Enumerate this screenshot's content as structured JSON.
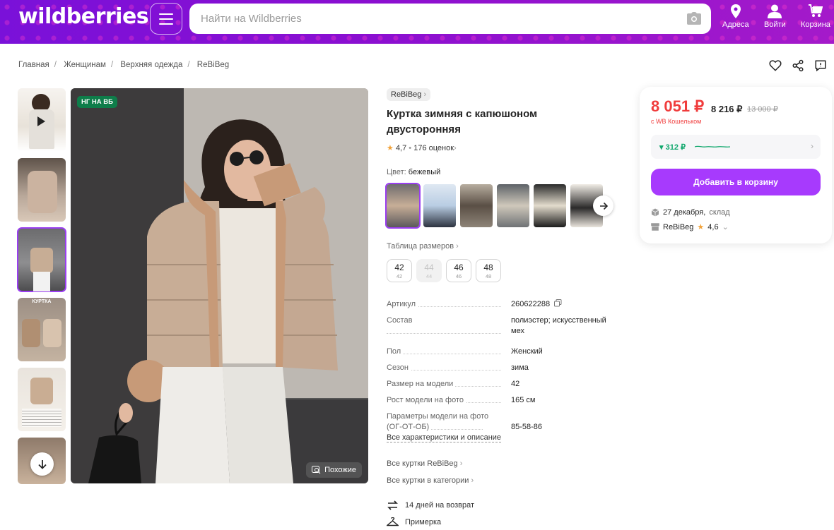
{
  "header": {
    "logo": "wildberries",
    "search_placeholder": "Найти на Wildberries",
    "addresses_label": "Адреса",
    "login_label": "Войти",
    "cart_label": "Корзина"
  },
  "breadcrumbs": [
    "Главная",
    "Женщинам",
    "Верхняя одежда",
    "ReBiBeg"
  ],
  "gallery": {
    "badge": "НГ НА ВБ",
    "similar_label": "Похожие",
    "thumb_label_4": "КУРТКА"
  },
  "product": {
    "brand": "ReBiBeg",
    "title": "Куртка зимняя с капюшоном двусторонняя",
    "rating": "4,7",
    "reviews": "176 оценок",
    "color_label": "Цвет:",
    "color_value": "бежевый",
    "size_table_label": "Таблица размеров",
    "sizes": [
      {
        "n": "42",
        "s": "42",
        "available": true
      },
      {
        "n": "44",
        "s": "44",
        "available": false
      },
      {
        "n": "46",
        "s": "46",
        "available": true
      },
      {
        "n": "48",
        "s": "48",
        "available": true
      }
    ],
    "specs": [
      {
        "k": "Артикул",
        "v": "260622288"
      },
      {
        "k": "Состав",
        "v": "полиэстер; искусственный мех"
      },
      {
        "k": "Пол",
        "v": "Женский"
      },
      {
        "k": "Сезон",
        "v": "зима"
      },
      {
        "k": "Размер на модели",
        "v": "42"
      },
      {
        "k": "Рост модели на фото",
        "v": "165 см"
      },
      {
        "k": "Параметры модели на фото (ОГ-ОТ-ОБ)",
        "v": "85-58-86"
      }
    ],
    "all_specs_label": "Все характеристики и описание",
    "link_brand": "Все куртки ReBiBeg",
    "link_category": "Все куртки в категории",
    "perk_return": "14 дней на возврат",
    "perk_fitting": "Примерка"
  },
  "buy": {
    "price": "8 051 ₽",
    "price_no_wallet": "8 216 ₽",
    "price_old": "13 000 ₽",
    "wallet_note": "с WB Кошельком",
    "price_drop": "▾ 312 ₽",
    "add_to_cart": "Добавить в корзину",
    "delivery_date": "27 декабря,",
    "delivery_from": "склад",
    "seller": "ReBiBeg",
    "seller_rating": "4,6"
  },
  "colors": {
    "accent": "#a73afd",
    "price_red": "#f03c3c",
    "header_purple": "#8b0fd0",
    "badge_green": "#0e7d4a"
  }
}
